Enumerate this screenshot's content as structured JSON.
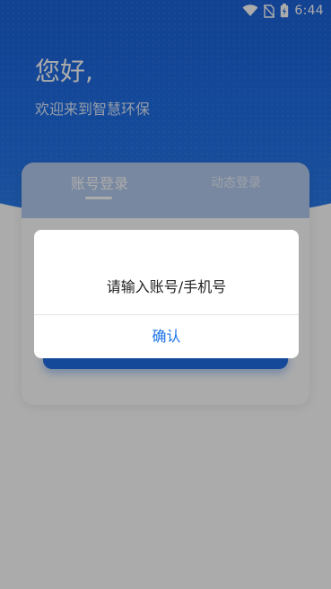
{
  "status_bar": {
    "time": "6:44",
    "icons": [
      "wifi-icon",
      "no-sim-icon",
      "battery-charging-icon"
    ]
  },
  "header": {
    "greeting": "您好,",
    "welcome": "欢迎来到智慧环保"
  },
  "login": {
    "tabs": [
      {
        "label": "账号登录",
        "active": true
      },
      {
        "label": "动态登录",
        "active": false
      }
    ]
  },
  "dialog": {
    "message": "请输入账号/手机号",
    "confirm_label": "确认"
  },
  "colors": {
    "brand_blue": "#1f6ee6",
    "link_blue": "#1a73e8"
  }
}
